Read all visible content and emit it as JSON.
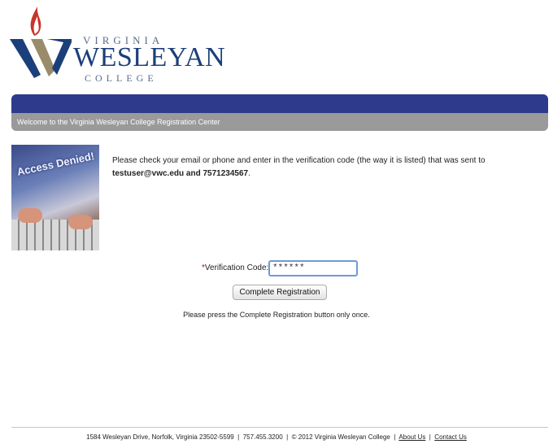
{
  "logo": {
    "line1": "VIRGINIA",
    "line2": "WESLEYAN",
    "line3": "COLLEGE",
    "colors": {
      "navy": "#1b3f7a",
      "gold": "#9a8b6a",
      "flame": "#c8342a"
    }
  },
  "header": {
    "welcome": "Welcome to the Virginia Wesleyan College Registration Center",
    "bar_color": "#2e3b8c",
    "subbar_color": "#9a9a9a"
  },
  "promo_image": {
    "caption": "Access Denied!"
  },
  "message": {
    "text": "Please check your email or phone and enter in the verification code (the way it is listed) that was sent to ",
    "email": "testuser@vwc.edu",
    "and": "and",
    "phone": "7571234567",
    "end": "."
  },
  "form": {
    "required_mark": "*",
    "label": "Verification Code:",
    "value": "******",
    "button": "Complete Registration",
    "note": "Please press the Complete Registration button only once."
  },
  "footer": {
    "address": "1584 Wesleyan Drive, Norfolk, Virginia 23502-5599",
    "sep": "|",
    "phone": "757.455.3200",
    "copyright": "© 2012 Virginia Wesleyan College",
    "about": "About Us",
    "contact": "Contact Us"
  }
}
